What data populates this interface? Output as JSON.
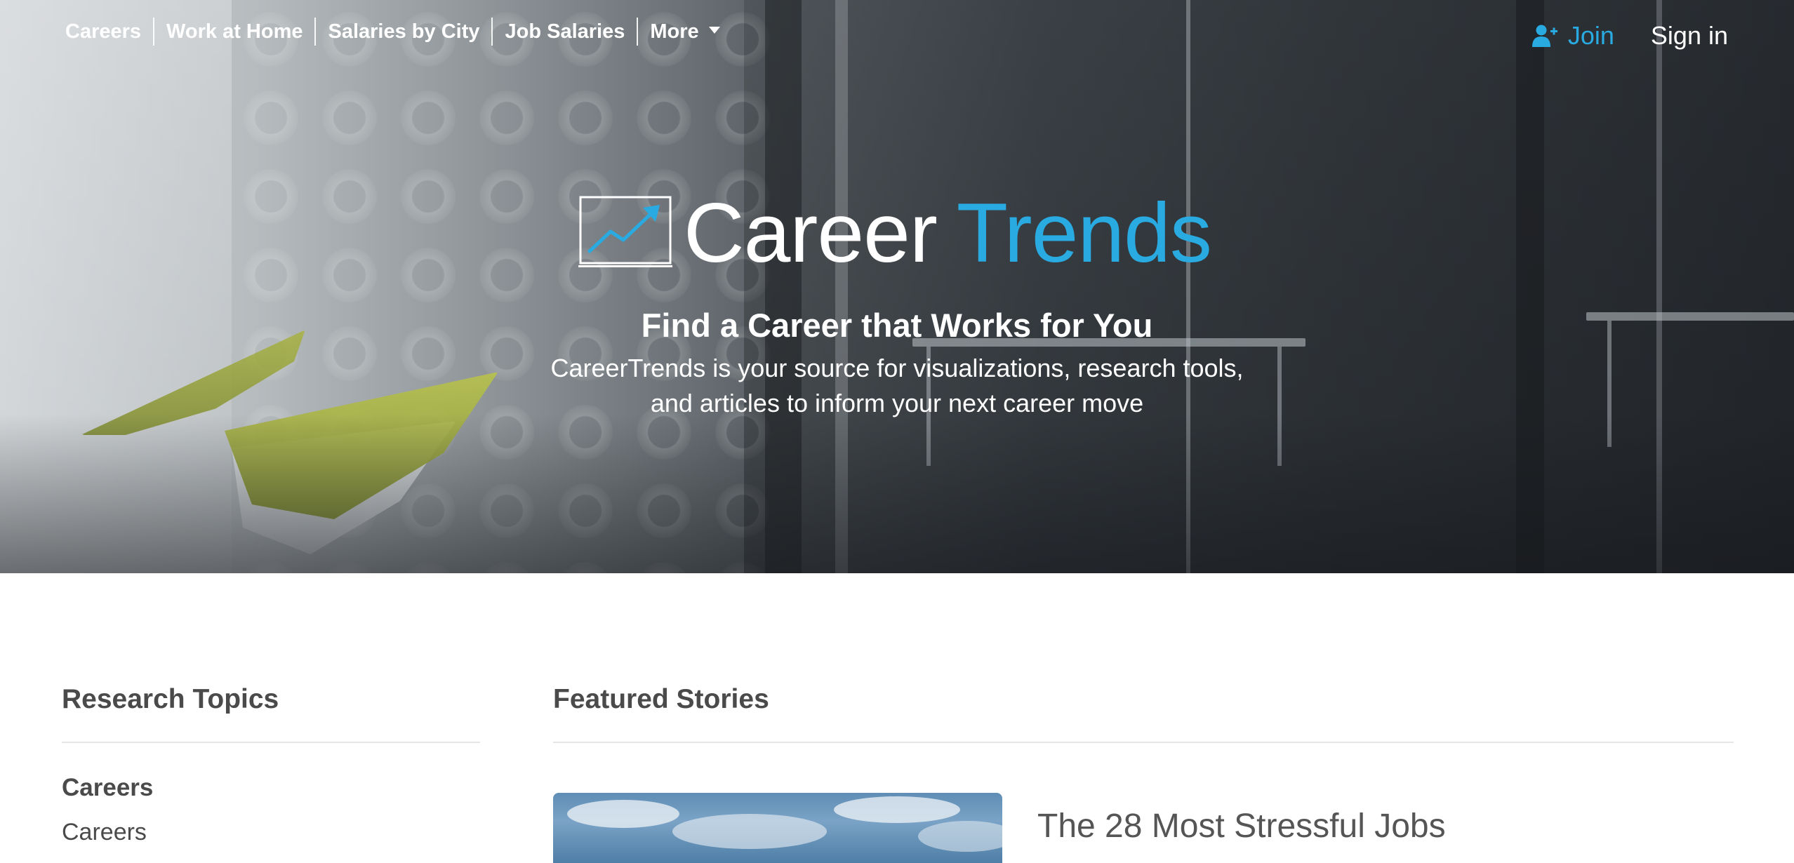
{
  "nav": {
    "items": [
      {
        "label": "Careers"
      },
      {
        "label": "Work at Home"
      },
      {
        "label": "Salaries by City"
      },
      {
        "label": "Job Salaries"
      },
      {
        "label": "More"
      }
    ]
  },
  "account": {
    "join_label": "Join",
    "signin_label": "Sign in"
  },
  "hero": {
    "logo_word1": "Career",
    "logo_word2": "Trends",
    "title": "Find a Career that Works for You",
    "subtitle_line1": "CareerTrends is your source for visualizations, research tools,",
    "subtitle_line2": "and articles to inform your next career move"
  },
  "research_topics": {
    "heading": "Research Topics",
    "group_title": "Careers",
    "items": [
      {
        "label": "Careers"
      }
    ]
  },
  "featured": {
    "heading": "Featured Stories",
    "stories": [
      {
        "title": "The 28 Most Stressful Jobs"
      }
    ]
  },
  "colors": {
    "accent": "#29abe2",
    "heading_text": "#4a4a4a",
    "hero_text": "#ffffff"
  },
  "icons": {
    "join": "add-user-icon",
    "logo": "trend-chart-icon",
    "more": "caret-down-icon"
  }
}
